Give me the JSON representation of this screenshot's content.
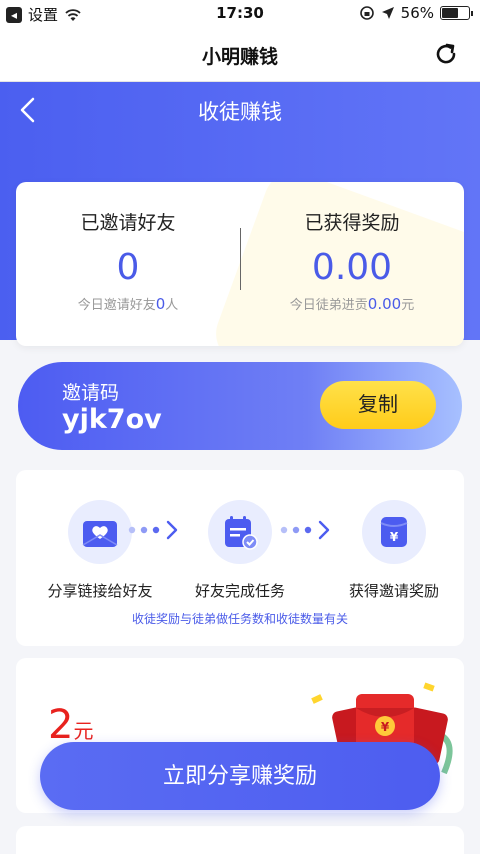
{
  "status_bar": {
    "back_label": "设置",
    "time": "17:30",
    "battery": "56%",
    "battery_level": 0.56
  },
  "app_bar": {
    "title": "小明赚钱"
  },
  "header": {
    "title": "收徒赚钱"
  },
  "stats": {
    "invited": {
      "label": "已邀请好友",
      "value": "0",
      "sub_prefix": "今日邀请好友",
      "sub_value": "0",
      "sub_suffix": "人"
    },
    "earned": {
      "label": "已获得奖励",
      "value": "0.00",
      "sub_prefix": "今日徒弟进贡",
      "sub_value": "0.00",
      "sub_suffix": "元"
    }
  },
  "invite": {
    "label": "邀请码",
    "code": "yjk7ov",
    "copy_label": "复制"
  },
  "steps": {
    "items": [
      {
        "label": "分享链接给好友",
        "icon": "heart-envelope-icon"
      },
      {
        "label": "好友完成任务",
        "icon": "task-check-icon"
      },
      {
        "label": "获得邀请奖励",
        "icon": "yuan-wallet-icon"
      }
    ],
    "note": "收徒奖励与徒弟做任务数和收徒数量有关"
  },
  "reward": {
    "amount": "2",
    "unit": "元"
  },
  "share_button": {
    "label": "立即分享赚奖励"
  },
  "colors": {
    "primary": "#4a5be8",
    "accent_yellow": "#ffd52e",
    "reward_red": "#e8221e"
  }
}
